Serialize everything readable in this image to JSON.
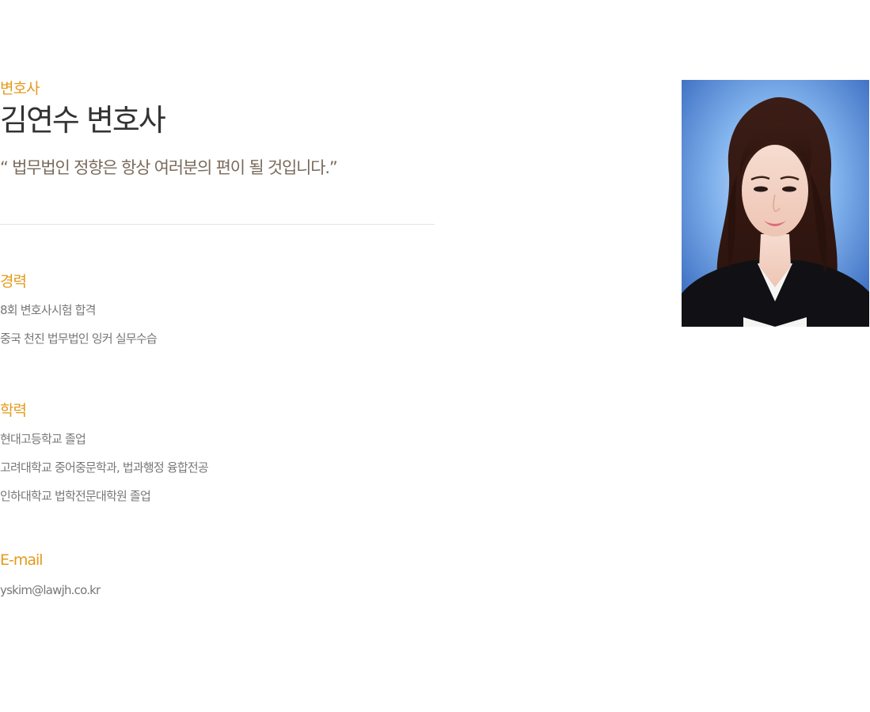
{
  "profile": {
    "role": "변호사",
    "name": "김연수 변호사",
    "quote": "“ 법무법인 정향은 항상 여러분의 편이 될 것입니다.”"
  },
  "career": {
    "title": "경력",
    "items": [
      "8회 변호사시험 합격",
      "중국 천진 법무법인 잉커 실무수습"
    ]
  },
  "education": {
    "title": "학력",
    "items": [
      "현대고등학교 졸업",
      "고려대학교 중어중문학과, 법과행정 융합전공",
      "인하대학교 법학전문대학원 졸업"
    ]
  },
  "email": {
    "title": "E-mail",
    "value": "yskim@lawjh.co.kr"
  },
  "colors": {
    "accent": "#e49a1c",
    "name": "#333333",
    "quote": "#7a6a5c",
    "body": "#777777"
  }
}
